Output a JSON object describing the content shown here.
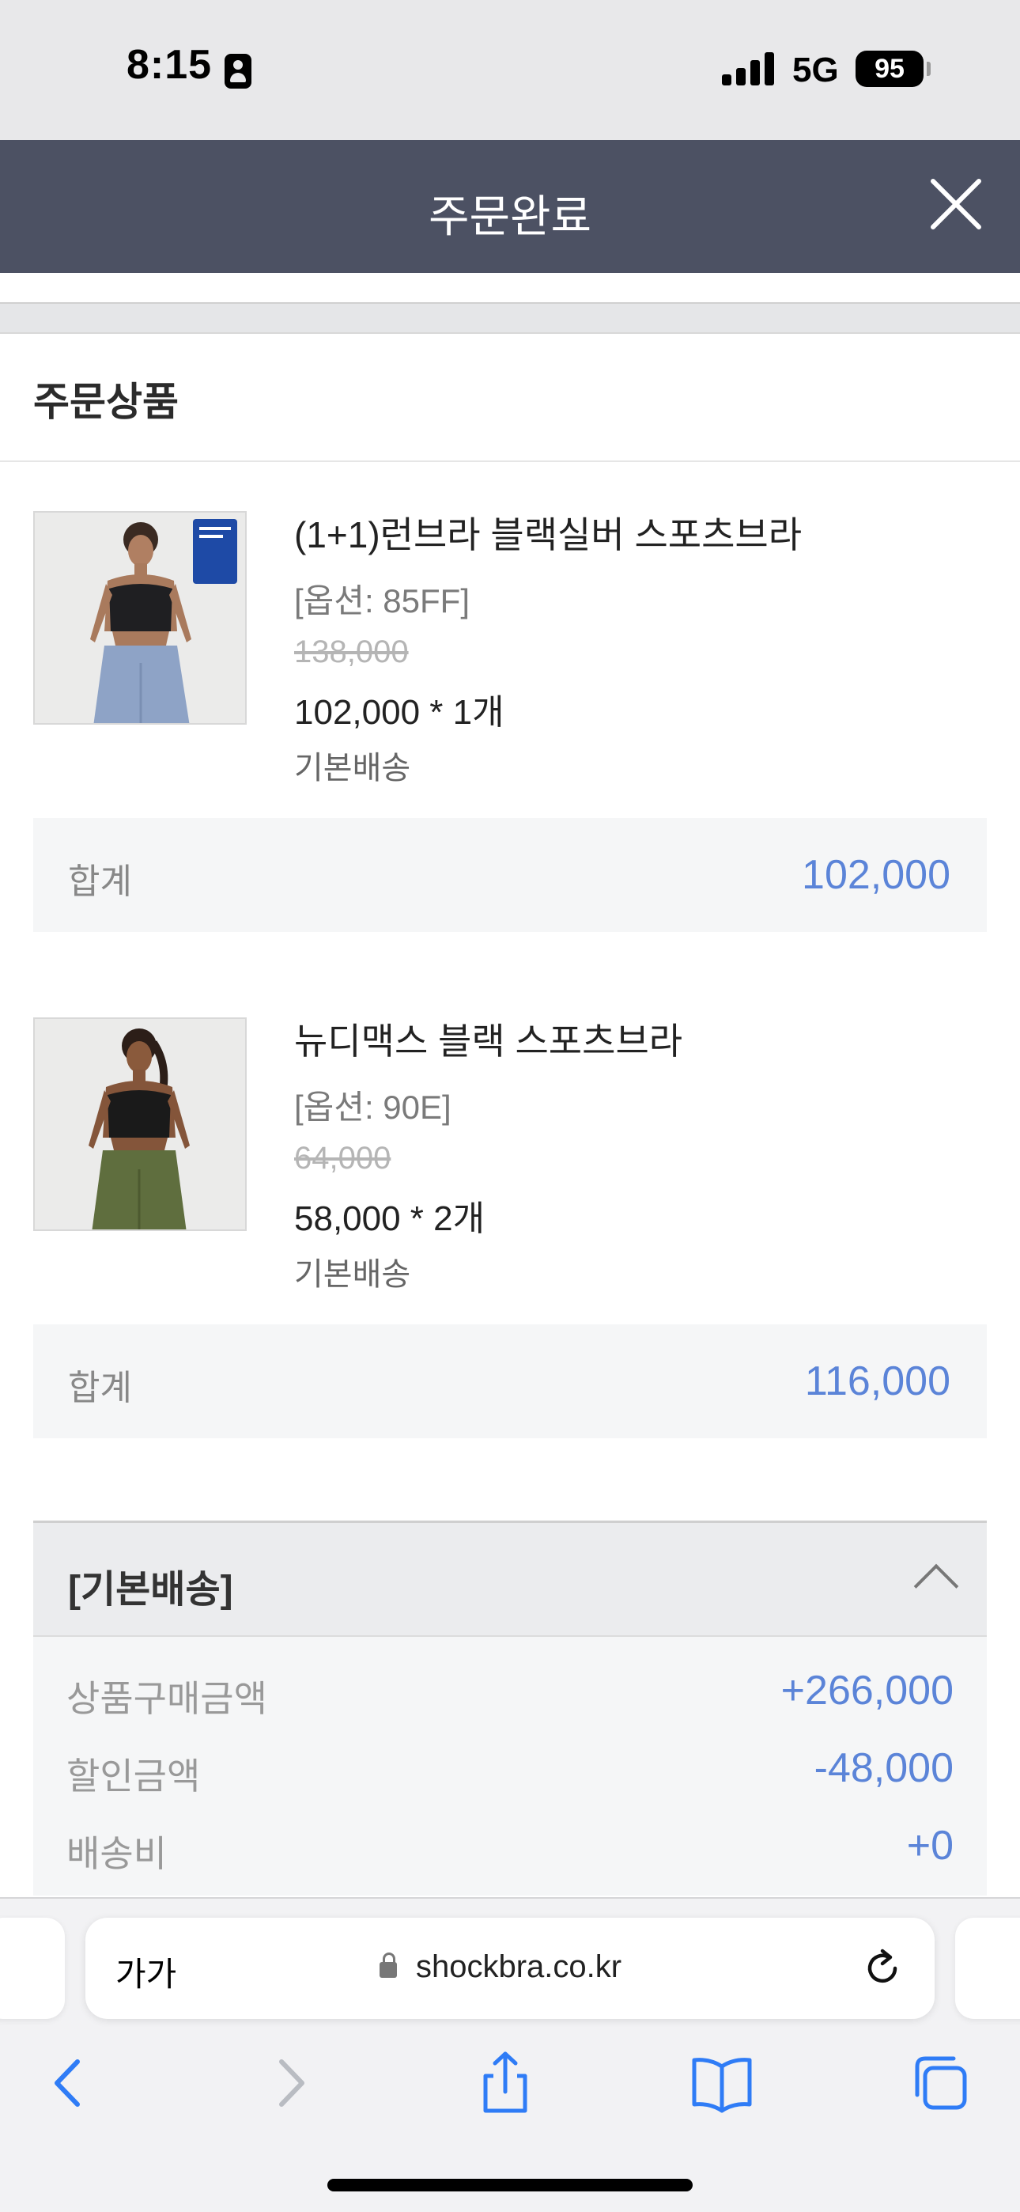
{
  "status_bar": {
    "time": "8:15",
    "network": "5G",
    "battery": "95"
  },
  "header": {
    "title": "주문완료"
  },
  "order_section": {
    "title": "주문상품"
  },
  "products": [
    {
      "name": "(1+1)런브라 블랙실버 스포츠브라",
      "option": "[옵션: 85FF]",
      "original_price": "138,000",
      "price_qty": "102,000 * 1개",
      "shipping": "기본배송",
      "total_label": "합계",
      "total_value": "102,000"
    },
    {
      "name": "뉴디맥스 블랙 스포츠브라",
      "option": "[옵션: 90E]",
      "original_price": "64,000",
      "price_qty": "58,000 * 2개",
      "shipping": "기본배송",
      "total_label": "합계",
      "total_value": "116,000"
    }
  ],
  "shipping_summary": {
    "title": "[기본배송]",
    "rows": [
      {
        "label": "상품구매금액",
        "value": "+266,000"
      },
      {
        "label": "할인금액",
        "value": "-48,000"
      },
      {
        "label": "배송비",
        "value": "+0"
      }
    ]
  },
  "browser": {
    "text_size_label": "가가",
    "url": "shockbra.co.kr"
  },
  "colors": {
    "header_bg": "#4c5163",
    "accent_value": "#5b84d8",
    "ios_blue": "#2f7cf6"
  },
  "icons": [
    "close-icon",
    "chevron-up-icon",
    "lock-icon",
    "reload-icon",
    "back-icon",
    "forward-icon",
    "share-icon",
    "bookmarks-icon",
    "tabs-icon"
  ]
}
